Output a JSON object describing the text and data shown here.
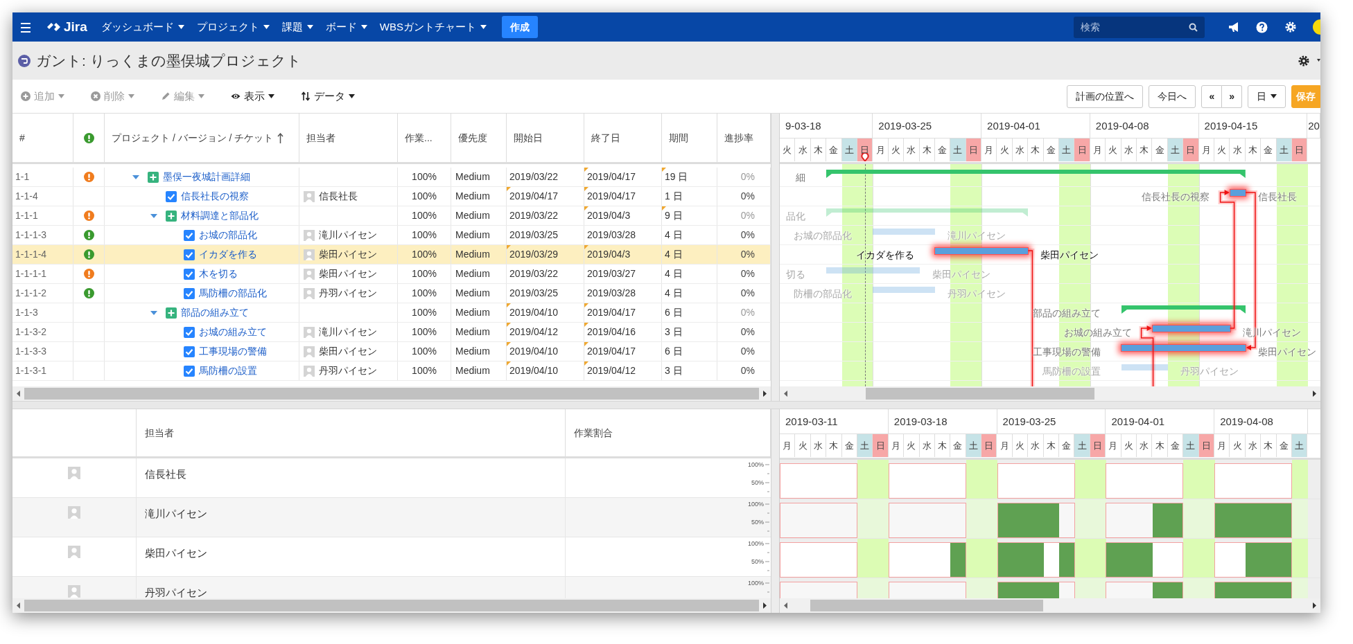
{
  "nav": {
    "logo": "Jira",
    "menus": [
      {
        "label": "ダッシュボード"
      },
      {
        "label": "プロジェクト"
      },
      {
        "label": "課題"
      },
      {
        "label": "ボード"
      },
      {
        "label": "WBSガントチャート"
      }
    ],
    "create": "作成",
    "search_placeholder": "検索"
  },
  "title": "ガント: りっくまの墨俣城プロジェクト",
  "toolbar": {
    "actions": [
      {
        "label": "追加",
        "kind": "plus",
        "disabled": true
      },
      {
        "label": "削除",
        "kind": "cross",
        "disabled": true
      },
      {
        "label": "編集",
        "kind": "pencil",
        "disabled": true
      },
      {
        "label": "表示",
        "kind": "eye",
        "disabled": false
      },
      {
        "label": "データ",
        "kind": "sort",
        "disabled": false
      }
    ],
    "buttons": [
      {
        "label": "計画の位置へ",
        "kind": "plain"
      },
      {
        "label": "今日へ",
        "kind": "plain"
      },
      {
        "label": "«",
        "kind": "group-left"
      },
      {
        "label": "»",
        "kind": "group-right"
      },
      {
        "label": "日",
        "kind": "dropdown"
      },
      {
        "label": "保存",
        "kind": "primary"
      }
    ]
  },
  "table": {
    "columns": [
      {
        "label": "#",
        "kind": "text",
        "sorted": false
      },
      {
        "kind": "flag",
        "sorted": false
      },
      {
        "label": "プロジェクト / バージョン / チケット",
        "kind": "text",
        "sorted": true
      },
      {
        "label": "担当者",
        "kind": "text",
        "sorted": false
      },
      {
        "label": "作業...",
        "kind": "text",
        "sorted": false
      },
      {
        "label": "優先度",
        "kind": "text",
        "sorted": false
      },
      {
        "label": "開始日",
        "kind": "text",
        "sorted": false
      },
      {
        "label": "終了日",
        "kind": "text",
        "sorted": false
      },
      {
        "label": "期間",
        "kind": "text",
        "sorted": false
      },
      {
        "label": "進捗率",
        "kind": "text",
        "sorted": false
      }
    ],
    "rows": [
      {
        "id": "1-1",
        "color": "#f07c1e",
        "kind": "summary",
        "expanded": true,
        "name": "墨俣一夜城計画詳細",
        "work": "100%",
        "priority": "Medium",
        "start": "2019/03/22",
        "end": "2019/04/17",
        "duration": "19 日",
        "progress": "0%",
        "start_edited": false,
        "end_edited": true,
        "duration_edited": true,
        "selected": false,
        "bar": {
          "label": "細",
          "dimmed": false
        },
        "children": [
          {
            "id": "1-1-4",
            "kind": "task",
            "name": "信長社長の視察",
            "assignee": "信長社長",
            "work": "100%",
            "priority": "Medium",
            "start": "2019/04/17",
            "end": "2019/04/17",
            "duration": "1 日",
            "progress": "0%",
            "start_edited": true,
            "end_edited": true,
            "duration_edited": false,
            "selected": false,
            "bar": {
              "label": "信長社長の視察",
              "assignee": "信長社長",
              "dimmed": false,
              "critical": true
            }
          },
          {
            "id": "1-1-1",
            "color": "#f07c1e",
            "kind": "summary",
            "expanded": true,
            "name": "材料調達と部品化",
            "work": "100%",
            "priority": "Medium",
            "start": "2019/03/22",
            "end": "2019/04/3",
            "duration": "9 日",
            "progress": "0%",
            "start_edited": false,
            "end_edited": true,
            "duration_edited": true,
            "selected": false,
            "bar": {
              "label": "品化",
              "dimmed": true
            },
            "children": [
              {
                "id": "1-1-1-3",
                "color": "#3a9a2f",
                "kind": "task",
                "name": "お城の部品化",
                "assignee": "滝川パイセン",
                "work": "100%",
                "priority": "Medium",
                "start": "2019/03/25",
                "end": "2019/03/28",
                "duration": "4 日",
                "progress": "0%",
                "start_edited": false,
                "end_edited": false,
                "duration_edited": false,
                "selected": false,
                "bar": {
                  "label": "お城の部品化",
                  "assignee": "滝川パイセン",
                  "dimmed": true,
                  "critical": false
                }
              },
              {
                "id": "1-1-1-4",
                "color": "#3a9a2f",
                "kind": "task",
                "name": "イカダを作る",
                "assignee": "柴田パイセン",
                "work": "100%",
                "priority": "Medium",
                "start": "2019/03/29",
                "end": "2019/04/3",
                "duration": "4 日",
                "progress": "0%",
                "start_edited": true,
                "end_edited": true,
                "duration_edited": false,
                "selected": true,
                "bar": {
                  "label": "イカダを作る",
                  "assignee": "柴田パイセン",
                  "dimmed": false,
                  "critical": true
                }
              },
              {
                "id": "1-1-1-1",
                "color": "#f07c1e",
                "kind": "task",
                "name": "木を切る",
                "assignee": "柴田パイセン",
                "work": "100%",
                "priority": "Medium",
                "start": "2019/03/22",
                "end": "2019/03/27",
                "duration": "4 日",
                "progress": "0%",
                "start_edited": false,
                "end_edited": false,
                "duration_edited": false,
                "selected": false,
                "bar": {
                  "label": "切る",
                  "assignee": "柴田パイセン",
                  "dimmed": true,
                  "critical": false
                }
              },
              {
                "id": "1-1-1-2",
                "color": "#3a9a2f",
                "kind": "task",
                "name": "馬防柵の部品化",
                "assignee": "丹羽パイセン",
                "work": "100%",
                "priority": "Medium",
                "start": "2019/03/25",
                "end": "2019/03/28",
                "duration": "4 日",
                "progress": "0%",
                "start_edited": false,
                "end_edited": false,
                "duration_edited": false,
                "selected": false,
                "bar": {
                  "label": "防柵の部品化",
                  "assignee": "丹羽パイセン",
                  "dimmed": true,
                  "critical": false
                }
              }
            ]
          },
          {
            "id": "1-1-3",
            "kind": "summary",
            "expanded": true,
            "name": "部品の組み立て",
            "work": "100%",
            "priority": "Medium",
            "start": "2019/04/10",
            "end": "2019/04/17",
            "duration": "6 日",
            "progress": "0%",
            "start_edited": true,
            "end_edited": true,
            "duration_edited": false,
            "selected": false,
            "bar": {
              "label": "部品の組み立て",
              "dimmed": false
            },
            "children": [
              {
                "id": "1-1-3-2",
                "kind": "task",
                "name": "お城の組み立て",
                "assignee": "滝川パイセン",
                "work": "100%",
                "priority": "Medium",
                "start": "2019/04/12",
                "end": "2019/04/16",
                "duration": "3 日",
                "progress": "0%",
                "start_edited": true,
                "end_edited": true,
                "duration_edited": false,
                "selected": false,
                "bar": {
                  "label": "お城の組み立て",
                  "assignee": "滝川パイセン",
                  "dimmed": false,
                  "critical": true
                }
              },
              {
                "id": "1-1-3-3",
                "kind": "task",
                "name": "工事現場の警備",
                "assignee": "柴田パイセン",
                "work": "100%",
                "priority": "Medium",
                "start": "2019/04/10",
                "end": "2019/04/17",
                "duration": "6 日",
                "progress": "0%",
                "start_edited": true,
                "end_edited": true,
                "duration_edited": false,
                "selected": false,
                "bar": {
                  "label": "工事現場の警備",
                  "assignee": "柴田パイセン",
                  "dimmed": false,
                  "critical": true
                }
              },
              {
                "id": "1-1-3-1",
                "kind": "task",
                "name": "馬防柵の設置",
                "assignee": "丹羽パイセン",
                "work": "100%",
                "priority": "Medium",
                "start": "2019/04/10",
                "end": "2019/04/12",
                "duration": "3 日",
                "progress": "0%",
                "start_edited": true,
                "end_edited": true,
                "duration_edited": false,
                "selected": false,
                "bar": {
                  "label": "馬防柵の設置",
                  "assignee": "丹羽パイセン",
                  "dimmed": true,
                  "critical": false
                }
              }
            ]
          }
        ]
      }
    ]
  },
  "gantt": {
    "weeks": [
      {
        "label": "9-03-18"
      },
      {
        "label": "2019-03-25"
      },
      {
        "label": "2019-04-01"
      },
      {
        "label": "2019-04-08"
      },
      {
        "label": "2019-04-15"
      },
      {
        "label": "20"
      }
    ],
    "days": [
      {
        "label": "火",
        "kind": "weekday",
        "today": false
      },
      {
        "label": "水",
        "kind": "weekday",
        "today": false
      },
      {
        "label": "木",
        "kind": "weekday",
        "today": false
      },
      {
        "label": "金",
        "kind": "weekday",
        "today": false
      },
      {
        "label": "土",
        "kind": "sat",
        "today": false
      },
      {
        "label": "日",
        "kind": "sun",
        "today": true
      },
      {
        "label": "月",
        "kind": "mon",
        "today": false
      },
      {
        "label": "火",
        "kind": "weekday",
        "today": false
      },
      {
        "label": "水",
        "kind": "weekday",
        "today": false
      },
      {
        "label": "木",
        "kind": "weekday",
        "today": false
      },
      {
        "label": "金",
        "kind": "weekday",
        "today": false
      },
      {
        "label": "土",
        "kind": "sat",
        "today": false
      },
      {
        "label": "日",
        "kind": "sun",
        "today": false
      },
      {
        "label": "月",
        "kind": "mon",
        "today": false
      },
      {
        "label": "火",
        "kind": "weekday",
        "today": false
      },
      {
        "label": "水",
        "kind": "weekday",
        "today": false
      },
      {
        "label": "木",
        "kind": "weekday",
        "today": false
      },
      {
        "label": "金",
        "kind": "weekday",
        "today": false
      },
      {
        "label": "土",
        "kind": "sat",
        "today": false
      },
      {
        "label": "日",
        "kind": "sun",
        "today": false
      },
      {
        "label": "月",
        "kind": "mon",
        "today": false
      },
      {
        "label": "火",
        "kind": "weekday",
        "today": false
      },
      {
        "label": "水",
        "kind": "weekday",
        "today": false
      },
      {
        "label": "木",
        "kind": "weekday",
        "today": false
      },
      {
        "label": "金",
        "kind": "weekday",
        "today": false
      },
      {
        "label": "土",
        "kind": "sat",
        "today": false
      },
      {
        "label": "日",
        "kind": "sun",
        "today": false
      },
      {
        "label": "月",
        "kind": "mon",
        "today": false
      },
      {
        "label": "火",
        "kind": "weekday",
        "today": false
      },
      {
        "label": "水",
        "kind": "weekday",
        "today": false
      },
      {
        "label": "木",
        "kind": "weekday",
        "today": false
      },
      {
        "label": "金",
        "kind": "weekday",
        "today": false
      },
      {
        "label": "土",
        "kind": "sat",
        "today": false
      },
      {
        "label": "日",
        "kind": "sun",
        "today": false
      }
    ]
  },
  "resources": {
    "columns": [
      {
        "label": "担当者"
      },
      {
        "label": "作業割合"
      }
    ],
    "rows": [
      {
        "name": "信長社長",
        "axis": [
          "100%",
          "50%"
        ],
        "days": [
          {
            "busy": false
          },
          {
            "busy": false
          },
          {
            "busy": false
          },
          {
            "busy": false
          },
          {
            "busy": false
          },
          {
            "busy": false
          },
          {
            "busy": false
          },
          {
            "busy": false
          },
          {
            "busy": false
          },
          {
            "busy": false
          },
          {
            "busy": false
          },
          {
            "busy": false
          },
          {
            "busy": false
          },
          {
            "busy": false
          },
          {
            "busy": false
          },
          {
            "busy": false
          },
          {
            "busy": false
          },
          {
            "busy": false
          },
          {
            "busy": false
          },
          {
            "busy": false
          },
          {
            "busy": false
          },
          {
            "busy": false
          },
          {
            "busy": false
          },
          {
            "busy": false
          },
          {
            "busy": false
          },
          {
            "busy": false
          },
          {
            "busy": false
          },
          {
            "busy": false
          },
          {
            "busy": false
          },
          {
            "busy": false
          },
          {
            "busy": false
          },
          {
            "busy": false
          },
          {
            "busy": false
          },
          {
            "busy": false
          }
        ]
      },
      {
        "name": "滝川パイセン",
        "axis": [
          "100%",
          "50%"
        ],
        "days": [
          {
            "busy": false
          },
          {
            "busy": false
          },
          {
            "busy": false
          },
          {
            "busy": false
          },
          {
            "busy": false
          },
          {
            "busy": false
          },
          {
            "busy": false
          },
          {
            "busy": false
          },
          {
            "busy": false
          },
          {
            "busy": false
          },
          {
            "busy": false
          },
          {
            "busy": false
          },
          {
            "busy": false
          },
          {
            "busy": false
          },
          {
            "busy": true
          },
          {
            "busy": true
          },
          {
            "busy": true
          },
          {
            "busy": true
          },
          {
            "busy": false
          },
          {
            "busy": false
          },
          {
            "busy": false
          },
          {
            "busy": false
          },
          {
            "busy": false
          },
          {
            "busy": false
          },
          {
            "busy": true
          },
          {
            "busy": true
          },
          {
            "busy": false
          },
          {
            "busy": false
          },
          {
            "busy": true
          },
          {
            "busy": true
          },
          {
            "busy": true
          },
          {
            "busy": true
          },
          {
            "busy": true
          },
          {
            "busy": false
          }
        ]
      },
      {
        "name": "柴田パイセン",
        "axis": [
          "100%",
          "50%"
        ],
        "days": [
          {
            "busy": false
          },
          {
            "busy": false
          },
          {
            "busy": false
          },
          {
            "busy": false
          },
          {
            "busy": false
          },
          {
            "busy": false
          },
          {
            "busy": false
          },
          {
            "busy": false
          },
          {
            "busy": false
          },
          {
            "busy": false
          },
          {
            "busy": false
          },
          {
            "busy": true
          },
          {
            "busy": false
          },
          {
            "busy": false
          },
          {
            "busy": true
          },
          {
            "busy": true
          },
          {
            "busy": true
          },
          {
            "busy": false
          },
          {
            "busy": true
          },
          {
            "busy": false
          },
          {
            "busy": false
          },
          {
            "busy": true
          },
          {
            "busy": true
          },
          {
            "busy": true
          },
          {
            "busy": false
          },
          {
            "busy": false
          },
          {
            "busy": false
          },
          {
            "busy": false
          },
          {
            "busy": false
          },
          {
            "busy": false
          },
          {
            "busy": true
          },
          {
            "busy": true
          },
          {
            "busy": true
          },
          {
            "busy": false
          }
        ]
      },
      {
        "name": "丹羽パイセン",
        "axis": [
          "100%"
        ],
        "days": [
          {
            "busy": false
          },
          {
            "busy": false
          },
          {
            "busy": false
          },
          {
            "busy": false
          },
          {
            "busy": false
          },
          {
            "busy": false
          },
          {
            "busy": false
          },
          {
            "busy": false
          },
          {
            "busy": false
          },
          {
            "busy": false
          },
          {
            "busy": false
          },
          {
            "busy": false
          },
          {
            "busy": false
          },
          {
            "busy": false
          },
          {
            "busy": true
          },
          {
            "busy": true
          },
          {
            "busy": true
          },
          {
            "busy": true
          },
          {
            "busy": false
          },
          {
            "busy": false
          },
          {
            "busy": false
          },
          {
            "busy": false
          },
          {
            "busy": false
          },
          {
            "busy": false
          },
          {
            "busy": true
          },
          {
            "busy": true
          },
          {
            "busy": false
          },
          {
            "busy": false
          },
          {
            "busy": true
          },
          {
            "busy": true
          },
          {
            "busy": true
          },
          {
            "busy": true
          },
          {
            "busy": true
          },
          {
            "busy": false
          }
        ]
      }
    ],
    "timeline": {
      "weeks": [
        {
          "label": "2019-03-11"
        },
        {
          "label": "2019-03-18"
        },
        {
          "label": "2019-03-25"
        },
        {
          "label": "2019-04-01"
        },
        {
          "label": "2019-04-08"
        }
      ],
      "days": [
        {
          "label": "月",
          "kind": "mon"
        },
        {
          "label": "火",
          "kind": "weekday"
        },
        {
          "label": "水",
          "kind": "weekday"
        },
        {
          "label": "木",
          "kind": "weekday"
        },
        {
          "label": "金",
          "kind": "weekday"
        },
        {
          "label": "土",
          "kind": "sat"
        },
        {
          "label": "日",
          "kind": "sun"
        },
        {
          "label": "月",
          "kind": "mon"
        },
        {
          "label": "火",
          "kind": "weekday"
        },
        {
          "label": "水",
          "kind": "weekday"
        },
        {
          "label": "木",
          "kind": "weekday"
        },
        {
          "label": "金",
          "kind": "weekday"
        },
        {
          "label": "土",
          "kind": "sat"
        },
        {
          "label": "日",
          "kind": "sun"
        },
        {
          "label": "月",
          "kind": "mon"
        },
        {
          "label": "火",
          "kind": "weekday"
        },
        {
          "label": "水",
          "kind": "weekday"
        },
        {
          "label": "木",
          "kind": "weekday"
        },
        {
          "label": "金",
          "kind": "weekday"
        },
        {
          "label": "土",
          "kind": "sat"
        },
        {
          "label": "日",
          "kind": "sun"
        },
        {
          "label": "月",
          "kind": "mon"
        },
        {
          "label": "火",
          "kind": "weekday"
        },
        {
          "label": "水",
          "kind": "weekday"
        },
        {
          "label": "木",
          "kind": "weekday"
        },
        {
          "label": "金",
          "kind": "weekday"
        },
        {
          "label": "土",
          "kind": "sat"
        },
        {
          "label": "日",
          "kind": "sun"
        },
        {
          "label": "月",
          "kind": "mon"
        },
        {
          "label": "火",
          "kind": "weekday"
        },
        {
          "label": "水",
          "kind": "weekday"
        },
        {
          "label": "木",
          "kind": "weekday"
        },
        {
          "label": "金",
          "kind": "weekday"
        },
        {
          "label": "土",
          "kind": "sat"
        }
      ]
    }
  }
}
